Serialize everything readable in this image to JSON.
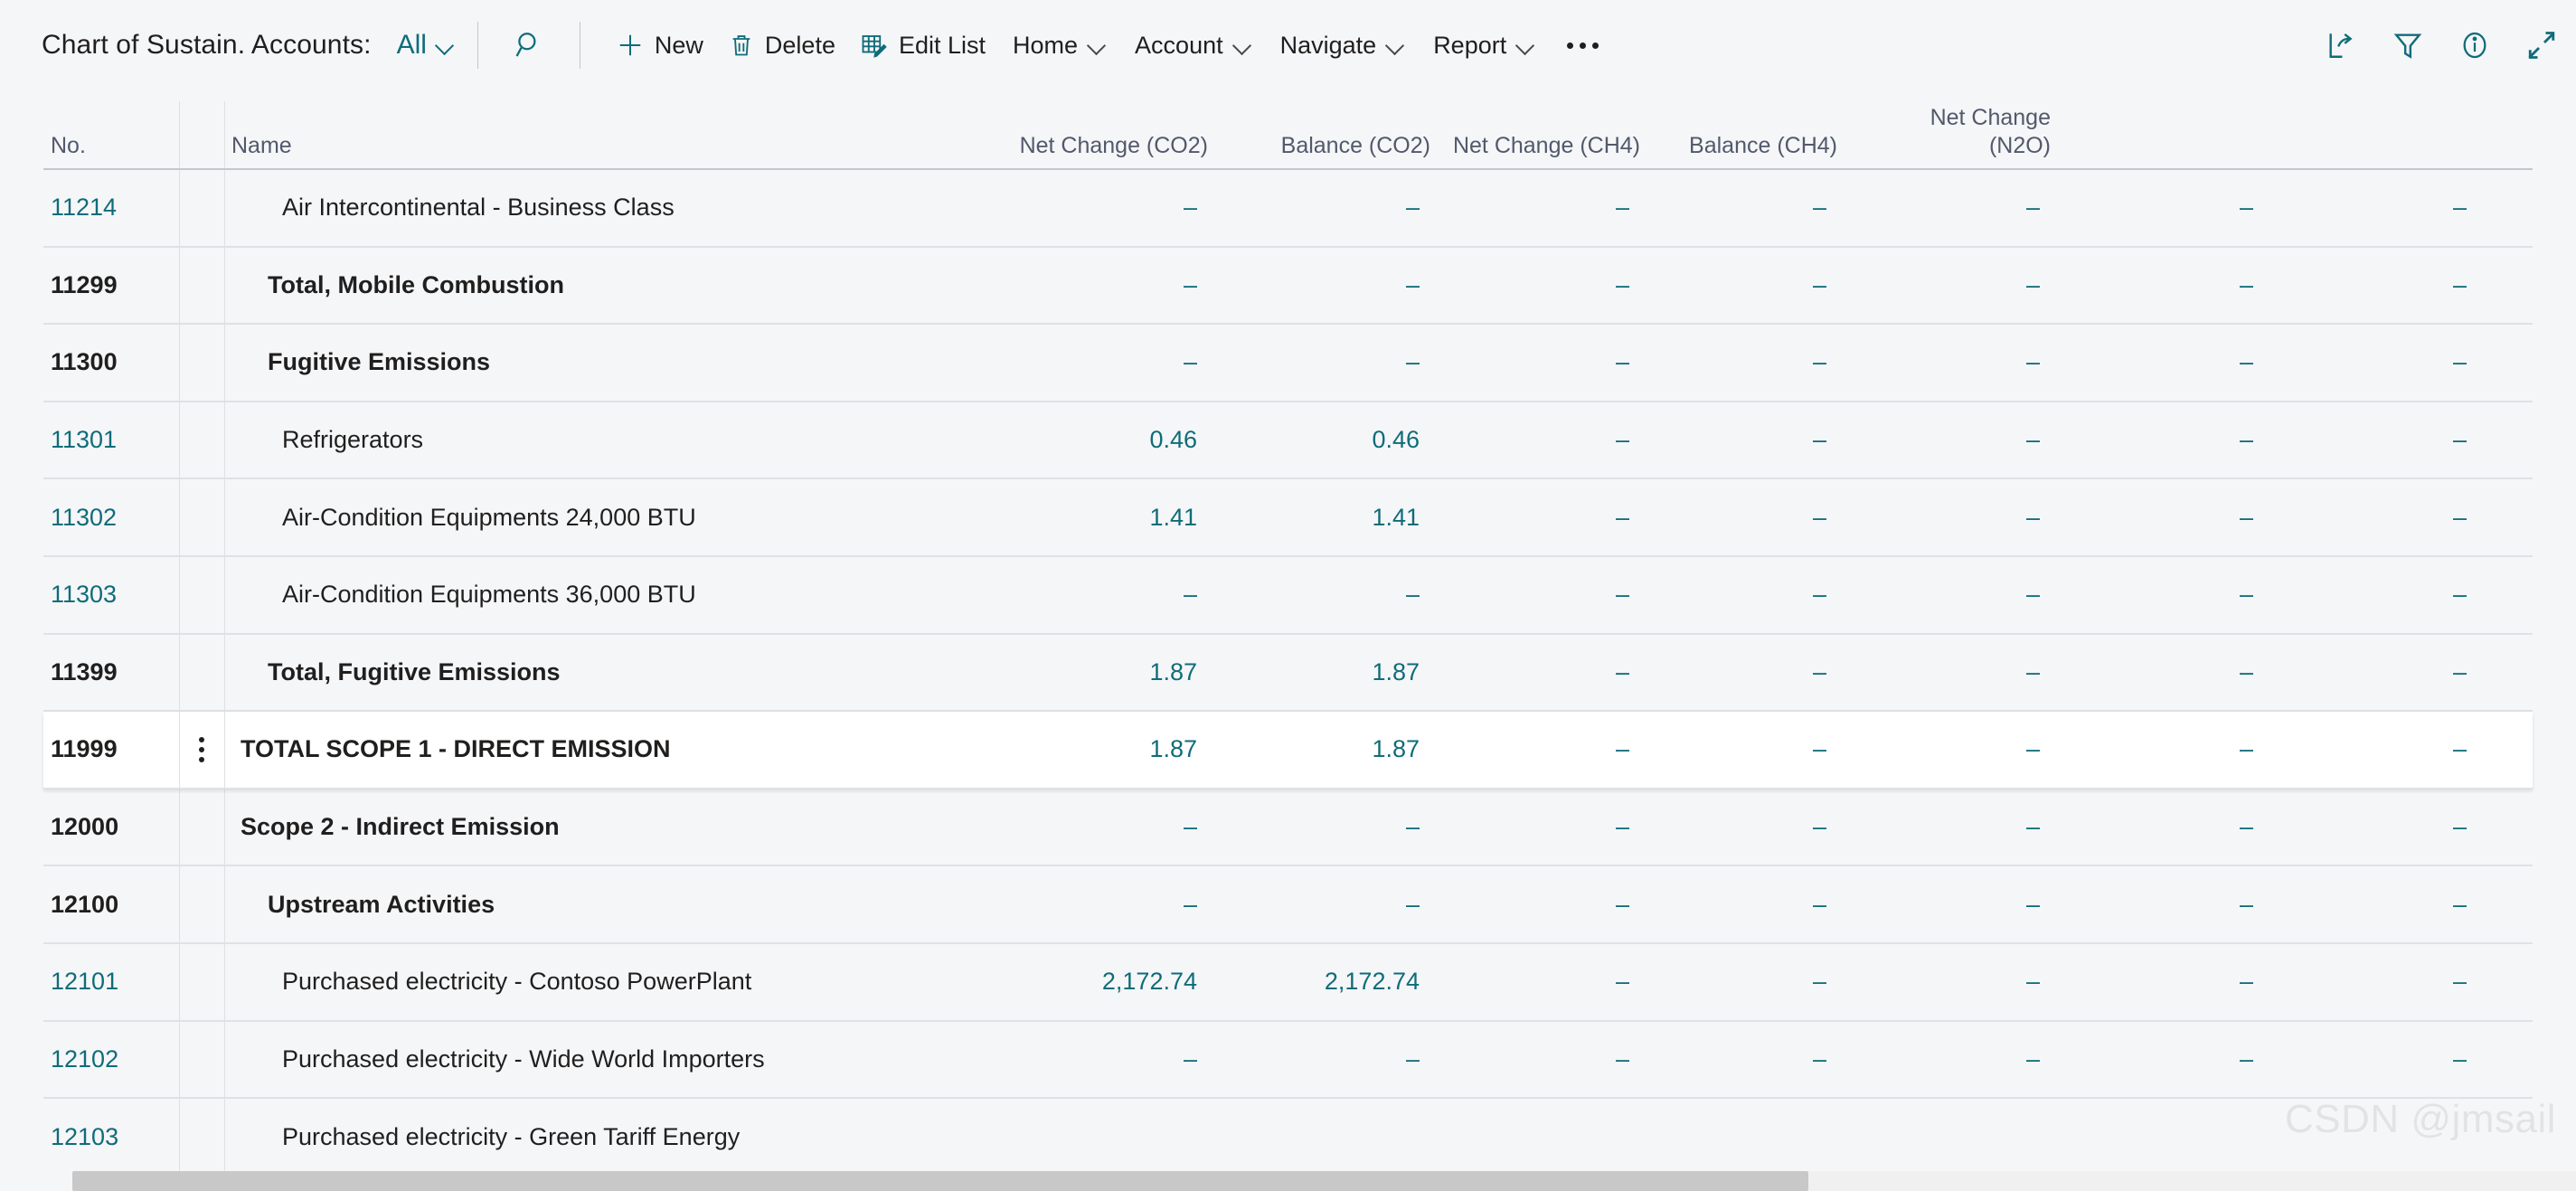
{
  "header": {
    "title": "Chart of Sustain. Accounts:",
    "view_filter": "All",
    "search_icon": "search-icon",
    "buttons": [
      {
        "label": "New",
        "icon": "plus-icon"
      },
      {
        "label": "Delete",
        "icon": "trash-icon"
      },
      {
        "label": "Edit List",
        "icon": "edit-list-icon"
      }
    ],
    "menus": [
      "Home",
      "Account",
      "Navigate",
      "Report"
    ],
    "overflow_label": "…",
    "right_icons": [
      "share-icon",
      "filter-icon",
      "info-icon",
      "collapse-icon"
    ]
  },
  "accent": "#0f6c79",
  "watermark": "CSDN @jmsail",
  "table": {
    "columns": [
      "No.",
      "Name",
      "Net Change (CO2)",
      "Balance (CO2)",
      "Net Change (CH4)",
      "Balance (CH4)",
      "Net Change (N2O)"
    ],
    "rows": [
      {
        "no": "11214",
        "name": "Air Intercontinental - Business Class",
        "indent": 2,
        "bold": false,
        "selected": false,
        "values": [
          "–",
          "–",
          "–",
          "–",
          "–",
          "–",
          "–"
        ]
      },
      {
        "no": "11299",
        "name": "Total, Mobile Combustion",
        "indent": 1,
        "bold": true,
        "selected": false,
        "values": [
          "–",
          "–",
          "–",
          "–",
          "–",
          "–",
          "–"
        ]
      },
      {
        "no": "11300",
        "name": "Fugitive Emissions",
        "indent": 1,
        "bold": true,
        "selected": false,
        "values": [
          "–",
          "–",
          "–",
          "–",
          "–",
          "–",
          "–"
        ]
      },
      {
        "no": "11301",
        "name": "Refrigerators",
        "indent": 2,
        "bold": false,
        "selected": false,
        "values": [
          "0.46",
          "0.46",
          "–",
          "–",
          "–",
          "–",
          "–"
        ]
      },
      {
        "no": "11302",
        "name": "Air-Condition Equipments 24,000 BTU",
        "indent": 2,
        "bold": false,
        "selected": false,
        "values": [
          "1.41",
          "1.41",
          "–",
          "–",
          "–",
          "–",
          "–"
        ]
      },
      {
        "no": "11303",
        "name": "Air-Condition Equipments 36,000 BTU",
        "indent": 2,
        "bold": false,
        "selected": false,
        "values": [
          "–",
          "–",
          "–",
          "–",
          "–",
          "–",
          "–"
        ]
      },
      {
        "no": "11399",
        "name": "Total, Fugitive Emissions",
        "indent": 1,
        "bold": true,
        "selected": false,
        "values": [
          "1.87",
          "1.87",
          "–",
          "–",
          "–",
          "–",
          "–"
        ]
      },
      {
        "no": "11999",
        "name": "TOTAL SCOPE 1 - DIRECT EMISSION",
        "indent": 0,
        "bold": true,
        "selected": true,
        "values": [
          "1.87",
          "1.87",
          "–",
          "–",
          "–",
          "–",
          "–"
        ]
      },
      {
        "no": "12000",
        "name": "Scope 2 - Indirect Emission",
        "indent": 0,
        "bold": true,
        "selected": false,
        "values": [
          "–",
          "–",
          "–",
          "–",
          "–",
          "–",
          "–"
        ]
      },
      {
        "no": "12100",
        "name": "Upstream Activities",
        "indent": 1,
        "bold": true,
        "selected": false,
        "values": [
          "–",
          "–",
          "–",
          "–",
          "–",
          "–",
          "–"
        ]
      },
      {
        "no": "12101",
        "name": "Purchased electricity - Contoso PowerPlant",
        "indent": 2,
        "bold": false,
        "selected": false,
        "values": [
          "2,172.74",
          "2,172.74",
          "–",
          "–",
          "–",
          "–",
          "–"
        ]
      },
      {
        "no": "12102",
        "name": "Purchased electricity - Wide World Importers",
        "indent": 2,
        "bold": false,
        "selected": false,
        "values": [
          "–",
          "–",
          "–",
          "–",
          "–",
          "–",
          "–"
        ]
      },
      {
        "no": "12103",
        "name": "Purchased electricity - Green Tariff Energy",
        "indent": 2,
        "bold": false,
        "selected": false,
        "values": [
          "",
          "",
          "",
          "",
          "",
          "",
          ""
        ]
      }
    ]
  }
}
